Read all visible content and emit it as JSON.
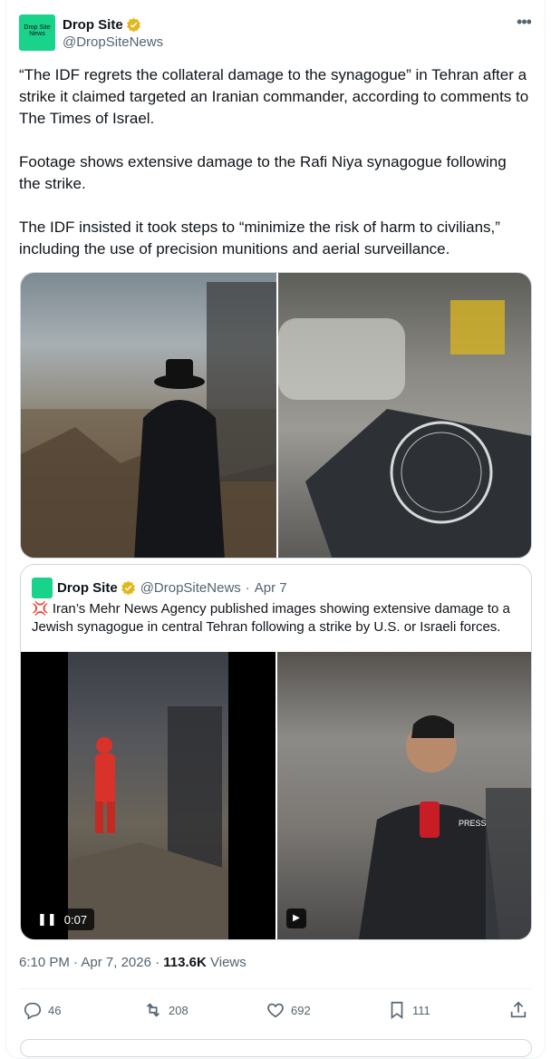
{
  "post": {
    "author_name": "Drop Site",
    "author_handle": "@DropSiteNews",
    "avatar_text": "Drop Site News",
    "more_label": "•••",
    "text": "“The IDF regrets the collateral damage to the synagogue” in Tehran after a strike it claimed targeted an Iranian commander, according to comments to The Times of Israel.\n\nFootage shows extensive damage to the Rafi Niya synagogue following the strike.\n\nThe IDF insisted it took steps to “minimize the risk of harm to civilians,” including the use of precision munitions and aerial surveillance.",
    "time": "6:10 PM",
    "date": "Apr 7, 2026",
    "views_count": "113.6K",
    "views_label": "Views"
  },
  "quote": {
    "author_name": "Drop Site",
    "author_handle": "@DropSiteNews",
    "date": "Apr 7",
    "emoji": "💢",
    "text": "Iran’s Mehr News Agency published images showing extensive damage to a Jewish synagogue in central Tehran following a strike by U.S. or Israeli forces.",
    "video_time": "0:07",
    "press_label": "PRESS"
  },
  "actions": {
    "replies": "46",
    "reposts": "208",
    "likes": "692",
    "bookmarks": "111"
  },
  "colors": {
    "brand": "#19d38a",
    "verified": "#e2b719",
    "secondary_text": "#536471",
    "border": "#cfd9de"
  }
}
